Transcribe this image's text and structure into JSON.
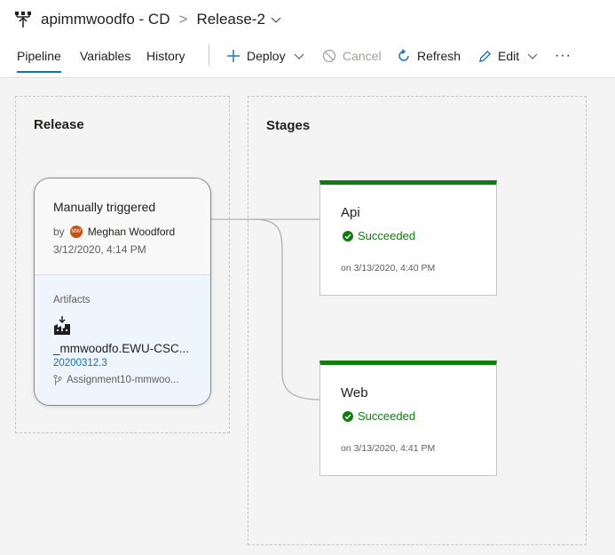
{
  "header": {
    "pipeline_name": "apimmwoodfo - CD",
    "separator": ">",
    "release_name": "Release-2"
  },
  "tabs": [
    {
      "label": "Pipeline",
      "active": true
    },
    {
      "label": "Variables",
      "active": false
    },
    {
      "label": "History",
      "active": false
    }
  ],
  "toolbar": {
    "deploy_label": "Deploy",
    "cancel_label": "Cancel",
    "refresh_label": "Refresh",
    "edit_label": "Edit",
    "more_label": "···"
  },
  "release_panel": {
    "title": "Release",
    "trigger": "Manually triggered",
    "by_label": "by",
    "avatar_initials": "MW",
    "user": "Meghan Woodford",
    "date": "3/12/2020, 4:14 PM",
    "artifacts_label": "Artifacts",
    "artifact_name": "_mmwoodfo.EWU-CSC...",
    "artifact_version": "20200312.3",
    "artifact_branch": "Assignment10-mmwoo..."
  },
  "stages_panel": {
    "title": "Stages",
    "stages": [
      {
        "name": "Api",
        "status": "Succeeded",
        "date": "on 3/13/2020, 4:40 PM"
      },
      {
        "name": "Web",
        "status": "Succeeded",
        "date": "on 3/13/2020, 4:41 PM"
      }
    ]
  },
  "colors": {
    "accent": "#106ebe",
    "success": "#107c10",
    "avatar": "#ca5010"
  },
  "icons": [
    "pipeline-icon",
    "chevron-down-icon",
    "plus-icon",
    "cancel-icon",
    "refresh-icon",
    "pencil-icon",
    "more-icon",
    "build-artifact-icon",
    "branch-icon",
    "success-check-icon"
  ]
}
